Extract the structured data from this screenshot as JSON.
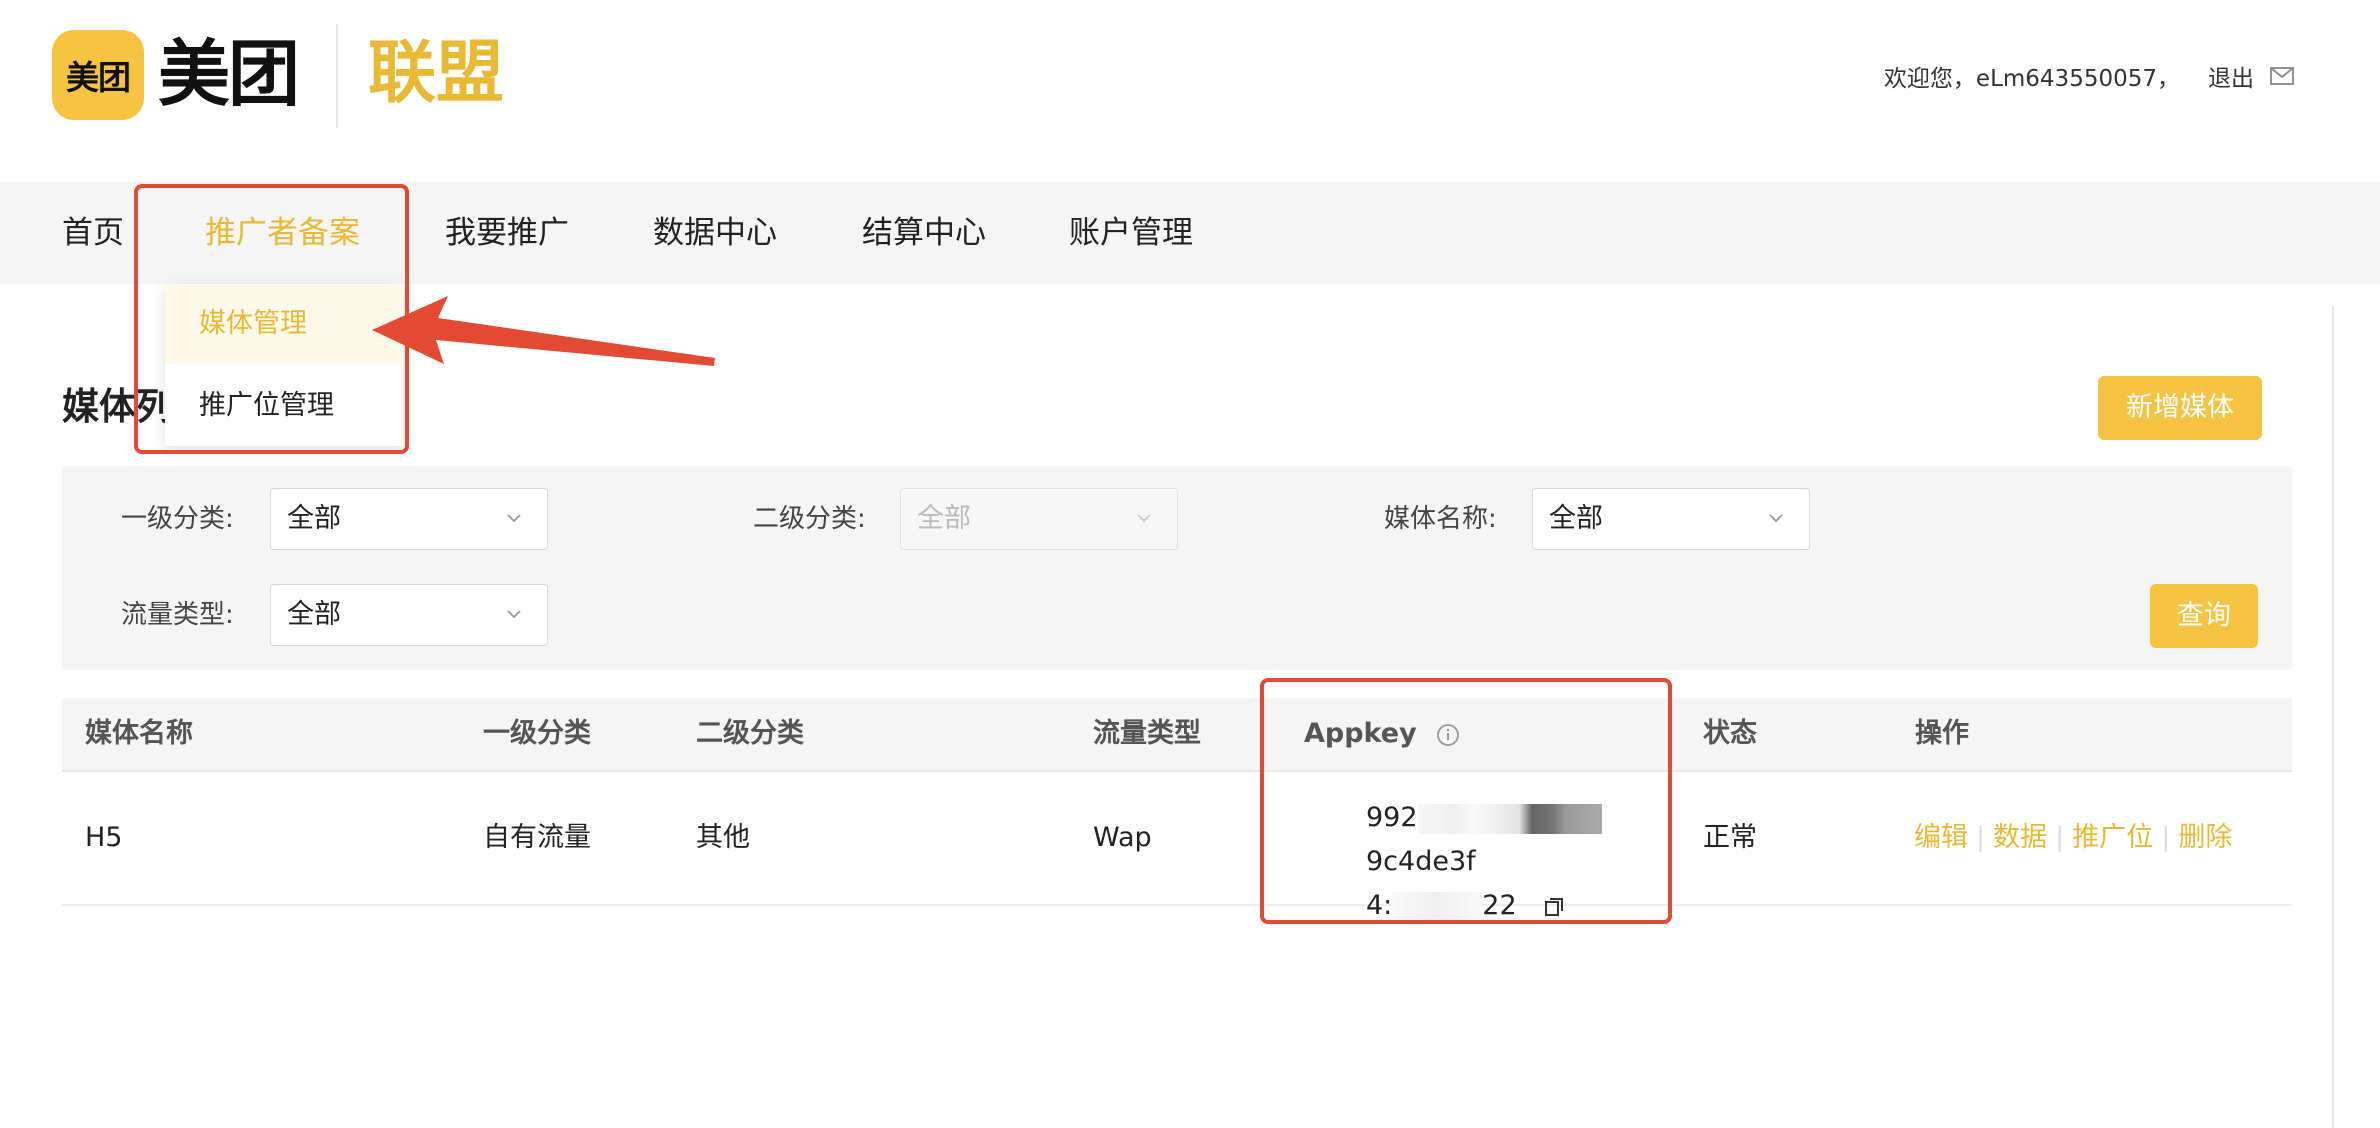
{
  "header": {
    "logo_badge": "美团",
    "logo_text": "美团",
    "logo_union": "联盟",
    "welcome": "欢迎您，eLm643550057，",
    "logout": "退出",
    "mail_icon": "mail-icon"
  },
  "nav": {
    "items": [
      {
        "label": "首页",
        "active": false
      },
      {
        "label": "推广者备案",
        "active": true
      },
      {
        "label": "我要推广",
        "active": false
      },
      {
        "label": "数据中心",
        "active": false
      },
      {
        "label": "结算中心",
        "active": false
      },
      {
        "label": "账户管理",
        "active": false
      }
    ]
  },
  "dropdown": {
    "items": [
      {
        "label": "媒体管理",
        "active": true
      },
      {
        "label": "推广位管理",
        "active": false
      }
    ]
  },
  "main": {
    "title": "媒体列表",
    "add_button": "新增媒体"
  },
  "filters": {
    "level1": {
      "label": "一级分类:",
      "value": "全部"
    },
    "level2": {
      "label": "二级分类:",
      "value": "全部",
      "disabled": true
    },
    "media_name": {
      "label": "媒体名称:",
      "value": "全部"
    },
    "traffic_type": {
      "label": "流量类型:",
      "value": "全部"
    },
    "query_button": "查询"
  },
  "table": {
    "columns": [
      "媒体名称",
      "一级分类",
      "二级分类",
      "流量类型",
      "Appkey",
      "状态",
      "操作"
    ],
    "rows": [
      {
        "media_name": "H5",
        "level1": "自有流量",
        "level2": "其他",
        "traffic_type": "Wap",
        "appkey_line1_start": "992",
        "appkey_line1_end": "9c4de3f",
        "appkey_line2_start": "4:",
        "appkey_line2_end": "22",
        "status": "正常",
        "actions": [
          "编辑",
          "数据",
          "推广位",
          "删除"
        ]
      }
    ]
  },
  "colors": {
    "accent": "#F6C343",
    "accent_text": "#E9B935",
    "annotation": "#E24A33"
  }
}
